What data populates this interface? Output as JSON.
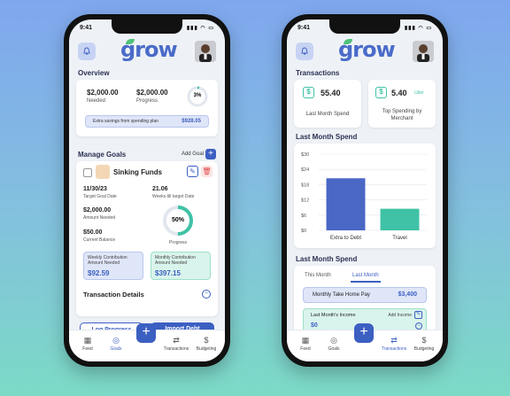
{
  "status_time": "9:41",
  "app": {
    "logo": "grow"
  },
  "left": {
    "overview_title": "Overview",
    "needed_amount": "$2,000.00",
    "needed_label": "Needed",
    "progress_amount": "$2,000.00",
    "progress_label": "Progress",
    "progress_pct": "3%",
    "progress_value": 0.03,
    "extra_text": "Extra savings from spending plan",
    "extra_amount": "$928.05",
    "manage_title": "Manage Goals",
    "add_goal": "Add Goal",
    "goal_name": "Sinking Funds",
    "target_date": "11/30/23",
    "target_date_label": "Target Goal Date",
    "weeks": "21.06",
    "weeks_label": "Weeks till target Date",
    "amount_needed": "$2,000.00",
    "amount_needed_label": "Amount Needed",
    "current_balance": "$50.00",
    "current_balance_label": "Current Balance",
    "ring_pct": "50%",
    "ring_label": "Progress",
    "ring_value": 0.5,
    "weekly_label": "Weekly Contribution Amount Needed",
    "weekly_amount": "$92.59",
    "monthly_label": "Monthly Contribution Amount Needed",
    "monthly_amount": "$397.15",
    "txn_details": "Transaction Details",
    "log_progress": "Log Progress",
    "import_debt": "Import Debt"
  },
  "right": {
    "transactions_title": "Transactions",
    "card1_amount": "55.40",
    "card1_label": "Last Month Spend",
    "card2_amount": "5.40",
    "card2_sub": "Uber",
    "card2_label": "Top Spending by Merchant",
    "chart_title": "Last Month Spend",
    "chart2_title": "Last Month Spend",
    "tab_this": "This Month",
    "tab_last": "Last Month",
    "take_home_label": "Monthly Take Home Pay",
    "take_home_amount": "$3,400",
    "income_label": "Last Month's Income",
    "income_amount": "$0",
    "add_income": "Add Income"
  },
  "chart_data": {
    "type": "bar",
    "categories": [
      "Extra to Debt",
      "Travel"
    ],
    "values": [
      20.5,
      8.5
    ],
    "yticks": [
      "$30",
      "$24",
      "$18",
      "$12",
      "$6",
      "$0"
    ],
    "ylim": [
      0,
      30
    ],
    "colors": [
      "#4a67c6",
      "#3fc2a6"
    ]
  },
  "nav": {
    "feed": "Feed",
    "goals": "Goals",
    "transactions": "Transactions",
    "budgeting": "Budgeting"
  },
  "icons": {
    "bell": "bell-icon",
    "feed": "grid-icon",
    "goals": "target-icon",
    "transactions": "swap-icon",
    "budgeting": "dollar-icon"
  },
  "colors": {
    "accent": "#3c5fc2",
    "green": "#3fc2a6"
  }
}
